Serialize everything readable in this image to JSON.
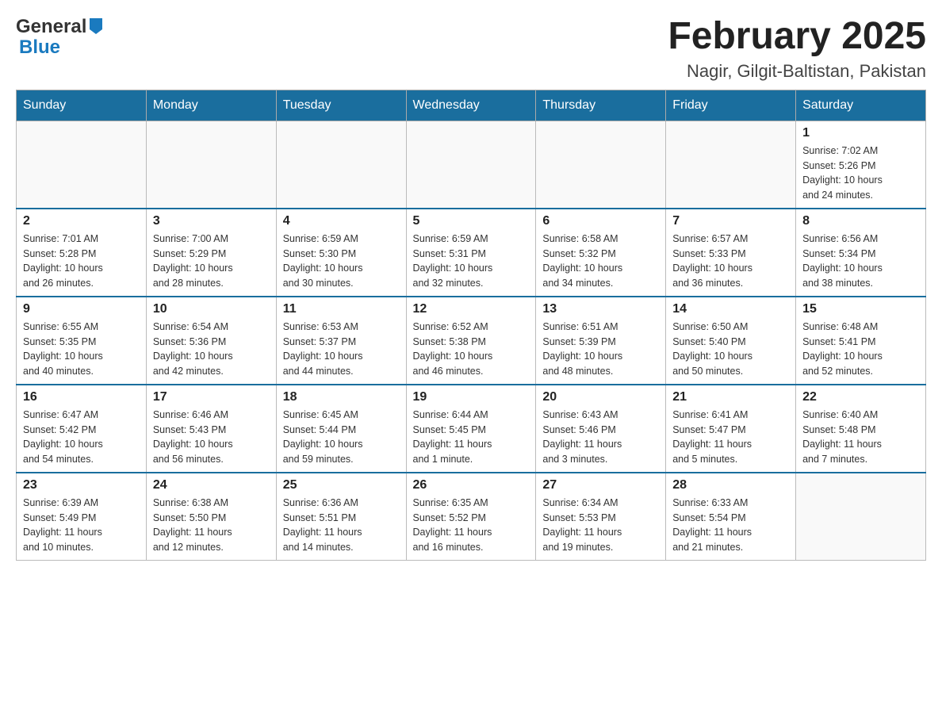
{
  "logo": {
    "text_general": "General",
    "text_blue": "Blue"
  },
  "title": {
    "month_year": "February 2025",
    "location": "Nagir, Gilgit-Baltistan, Pakistan"
  },
  "weekdays": [
    "Sunday",
    "Monday",
    "Tuesday",
    "Wednesday",
    "Thursday",
    "Friday",
    "Saturday"
  ],
  "weeks": [
    {
      "days": [
        {
          "number": "",
          "info": ""
        },
        {
          "number": "",
          "info": ""
        },
        {
          "number": "",
          "info": ""
        },
        {
          "number": "",
          "info": ""
        },
        {
          "number": "",
          "info": ""
        },
        {
          "number": "",
          "info": ""
        },
        {
          "number": "1",
          "info": "Sunrise: 7:02 AM\nSunset: 5:26 PM\nDaylight: 10 hours\nand 24 minutes."
        }
      ]
    },
    {
      "days": [
        {
          "number": "2",
          "info": "Sunrise: 7:01 AM\nSunset: 5:28 PM\nDaylight: 10 hours\nand 26 minutes."
        },
        {
          "number": "3",
          "info": "Sunrise: 7:00 AM\nSunset: 5:29 PM\nDaylight: 10 hours\nand 28 minutes."
        },
        {
          "number": "4",
          "info": "Sunrise: 6:59 AM\nSunset: 5:30 PM\nDaylight: 10 hours\nand 30 minutes."
        },
        {
          "number": "5",
          "info": "Sunrise: 6:59 AM\nSunset: 5:31 PM\nDaylight: 10 hours\nand 32 minutes."
        },
        {
          "number": "6",
          "info": "Sunrise: 6:58 AM\nSunset: 5:32 PM\nDaylight: 10 hours\nand 34 minutes."
        },
        {
          "number": "7",
          "info": "Sunrise: 6:57 AM\nSunset: 5:33 PM\nDaylight: 10 hours\nand 36 minutes."
        },
        {
          "number": "8",
          "info": "Sunrise: 6:56 AM\nSunset: 5:34 PM\nDaylight: 10 hours\nand 38 minutes."
        }
      ]
    },
    {
      "days": [
        {
          "number": "9",
          "info": "Sunrise: 6:55 AM\nSunset: 5:35 PM\nDaylight: 10 hours\nand 40 minutes."
        },
        {
          "number": "10",
          "info": "Sunrise: 6:54 AM\nSunset: 5:36 PM\nDaylight: 10 hours\nand 42 minutes."
        },
        {
          "number": "11",
          "info": "Sunrise: 6:53 AM\nSunset: 5:37 PM\nDaylight: 10 hours\nand 44 minutes."
        },
        {
          "number": "12",
          "info": "Sunrise: 6:52 AM\nSunset: 5:38 PM\nDaylight: 10 hours\nand 46 minutes."
        },
        {
          "number": "13",
          "info": "Sunrise: 6:51 AM\nSunset: 5:39 PM\nDaylight: 10 hours\nand 48 minutes."
        },
        {
          "number": "14",
          "info": "Sunrise: 6:50 AM\nSunset: 5:40 PM\nDaylight: 10 hours\nand 50 minutes."
        },
        {
          "number": "15",
          "info": "Sunrise: 6:48 AM\nSunset: 5:41 PM\nDaylight: 10 hours\nand 52 minutes."
        }
      ]
    },
    {
      "days": [
        {
          "number": "16",
          "info": "Sunrise: 6:47 AM\nSunset: 5:42 PM\nDaylight: 10 hours\nand 54 minutes."
        },
        {
          "number": "17",
          "info": "Sunrise: 6:46 AM\nSunset: 5:43 PM\nDaylight: 10 hours\nand 56 minutes."
        },
        {
          "number": "18",
          "info": "Sunrise: 6:45 AM\nSunset: 5:44 PM\nDaylight: 10 hours\nand 59 minutes."
        },
        {
          "number": "19",
          "info": "Sunrise: 6:44 AM\nSunset: 5:45 PM\nDaylight: 11 hours\nand 1 minute."
        },
        {
          "number": "20",
          "info": "Sunrise: 6:43 AM\nSunset: 5:46 PM\nDaylight: 11 hours\nand 3 minutes."
        },
        {
          "number": "21",
          "info": "Sunrise: 6:41 AM\nSunset: 5:47 PM\nDaylight: 11 hours\nand 5 minutes."
        },
        {
          "number": "22",
          "info": "Sunrise: 6:40 AM\nSunset: 5:48 PM\nDaylight: 11 hours\nand 7 minutes."
        }
      ]
    },
    {
      "days": [
        {
          "number": "23",
          "info": "Sunrise: 6:39 AM\nSunset: 5:49 PM\nDaylight: 11 hours\nand 10 minutes."
        },
        {
          "number": "24",
          "info": "Sunrise: 6:38 AM\nSunset: 5:50 PM\nDaylight: 11 hours\nand 12 minutes."
        },
        {
          "number": "25",
          "info": "Sunrise: 6:36 AM\nSunset: 5:51 PM\nDaylight: 11 hours\nand 14 minutes."
        },
        {
          "number": "26",
          "info": "Sunrise: 6:35 AM\nSunset: 5:52 PM\nDaylight: 11 hours\nand 16 minutes."
        },
        {
          "number": "27",
          "info": "Sunrise: 6:34 AM\nSunset: 5:53 PM\nDaylight: 11 hours\nand 19 minutes."
        },
        {
          "number": "28",
          "info": "Sunrise: 6:33 AM\nSunset: 5:54 PM\nDaylight: 11 hours\nand 21 minutes."
        },
        {
          "number": "",
          "info": ""
        }
      ]
    }
  ]
}
